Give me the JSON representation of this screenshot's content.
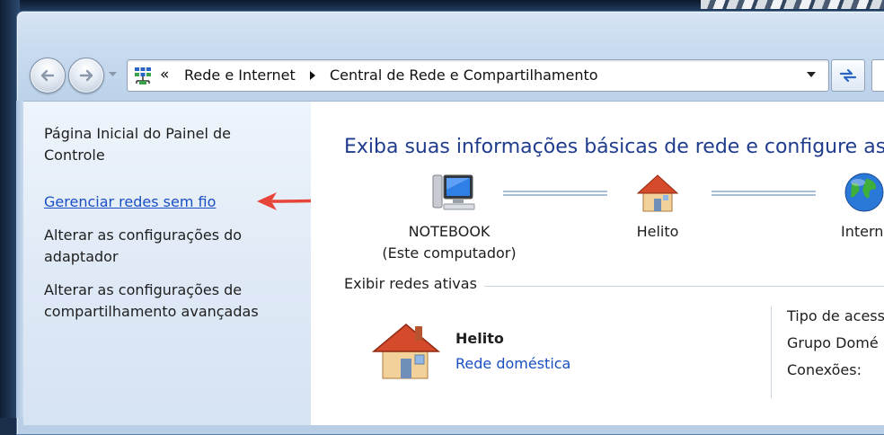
{
  "address_bar": {
    "overflow_chevron": "«",
    "crumbs": [
      "Rede e Internet",
      "Central de Rede e Compartilhamento"
    ]
  },
  "task_pane": {
    "items": [
      {
        "label": "Página Inicial do Painel de Controle"
      },
      {
        "label": "Gerenciar redes sem fio"
      },
      {
        "label": "Alterar as configurações do adaptador"
      },
      {
        "label": "Alterar as configurações de compartilhamento avançadas"
      }
    ]
  },
  "main": {
    "title": "Exiba suas informações básicas de rede e configure as c",
    "map": {
      "computer_name": "NOTEBOOK",
      "computer_sub": "(Este computador)",
      "network_name": "Helito",
      "internet_label": "Intern"
    },
    "active_networks_label": "Exibir redes ativas",
    "active_network": {
      "name": "Helito",
      "type_link": "Rede doméstica",
      "properties": [
        "Tipo de acess",
        "Grupo Domé",
        "Conexões:"
      ]
    }
  },
  "colors": {
    "link_blue": "#1a4fc4",
    "title_blue": "#1f3d8c",
    "annotation_arrow": "#e8453a"
  }
}
